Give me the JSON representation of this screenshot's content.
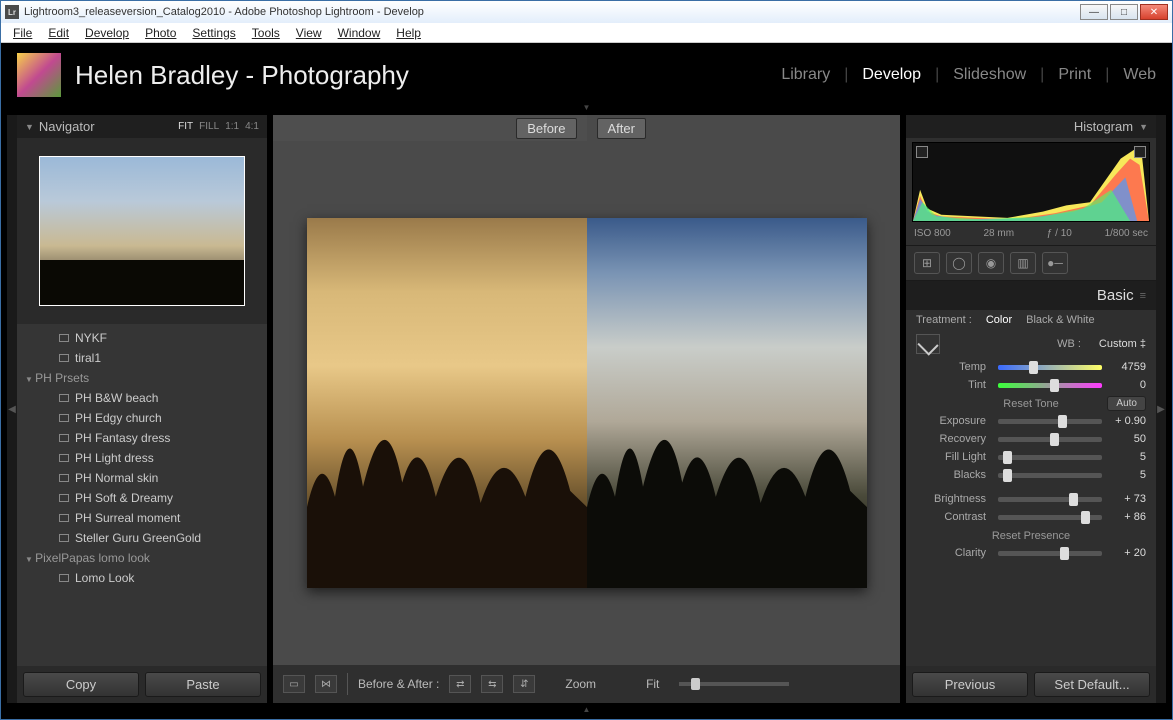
{
  "window": {
    "title": "Lightroom3_releaseversion_Catalog2010 - Adobe Photoshop Lightroom - Develop"
  },
  "menu": [
    "File",
    "Edit",
    "Develop",
    "Photo",
    "Settings",
    "Tools",
    "View",
    "Window",
    "Help"
  ],
  "identity": {
    "title": "Helen Bradley - Photography"
  },
  "modules": {
    "items": [
      "Library",
      "Develop",
      "Slideshow",
      "Print",
      "Web"
    ],
    "active": "Develop"
  },
  "navigator": {
    "title": "Navigator",
    "zoom_opts": [
      "FIT",
      "FILL",
      "1:1",
      "4:1"
    ],
    "zoom_active": "FIT"
  },
  "presets": {
    "loose": [
      "NYKF",
      "tiral1"
    ],
    "folder1": {
      "name": "PH Prsets",
      "items": [
        "PH B&W beach",
        "PH Edgy church",
        "PH Fantasy dress",
        "PH Light dress",
        "PH Normal skin",
        "PH Soft & Dreamy",
        "PH Surreal moment",
        "Steller Guru GreenGold"
      ]
    },
    "folder2": {
      "name": "PixelPapas lomo look",
      "items": [
        "Lomo Look"
      ]
    }
  },
  "left_buttons": {
    "copy": "Copy",
    "paste": "Paste"
  },
  "center": {
    "before": "Before",
    "after": "After",
    "toolbar_label": "Before & After :",
    "zoom_label": "Zoom",
    "fit_label": "Fit"
  },
  "right": {
    "histogram": "Histogram",
    "meta": {
      "iso": "ISO 800",
      "focal": "28 mm",
      "aperture": "ƒ / 10",
      "shutter": "1/800 sec"
    },
    "basic": "Basic",
    "treatment_label": "Treatment :",
    "treatment_color": "Color",
    "treatment_bw": "Black & White",
    "wb_label": "WB :",
    "wb_value": "Custom ‡",
    "sliders": {
      "temp": {
        "label": "Temp",
        "value": "4759",
        "pos": 30
      },
      "tint": {
        "label": "Tint",
        "value": "0",
        "pos": 50
      },
      "tone_hdr": "Reset Tone",
      "auto": "Auto",
      "exposure": {
        "label": "Exposure",
        "value": "+ 0.90",
        "pos": 58
      },
      "recovery": {
        "label": "Recovery",
        "value": "50",
        "pos": 50
      },
      "fill": {
        "label": "Fill Light",
        "value": "5",
        "pos": 5
      },
      "blacks": {
        "label": "Blacks",
        "value": "5",
        "pos": 5
      },
      "brightness": {
        "label": "Brightness",
        "value": "+ 73",
        "pos": 68
      },
      "contrast": {
        "label": "Contrast",
        "value": "+ 86",
        "pos": 80
      },
      "presence_hdr": "Reset Presence",
      "clarity": {
        "label": "Clarity",
        "value": "+ 20",
        "pos": 60
      }
    },
    "buttons": {
      "previous": "Previous",
      "setdefault": "Set Default..."
    }
  }
}
